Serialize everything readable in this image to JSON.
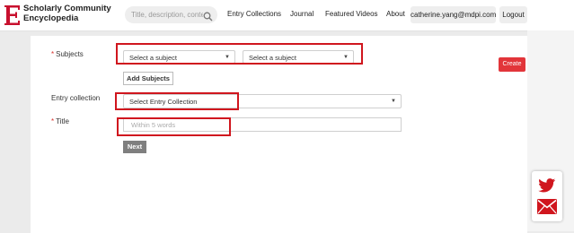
{
  "header": {
    "logo_letter": "E",
    "logo_line1": "Scholarly Community",
    "logo_line2": "Encyclopedia",
    "search_placeholder": "Title, description, content",
    "nav": {
      "entry_collections": "Entry Collections",
      "journal": "Journal",
      "featured_videos": "Featured Videos",
      "about": "About",
      "user_email": "catherine.yang@mdpi.com",
      "logout": "Logout"
    }
  },
  "form": {
    "subjects_label": "Subjects",
    "subject_select_1": "Select a subject",
    "subject_select_2": "Select a subject",
    "add_subjects": "Add Subjects",
    "entry_collection_label": "Entry collection",
    "entry_collection_select": "Select Entry Collection",
    "title_label": "Title",
    "title_placeholder": "Within 5 words",
    "required_mark": "*",
    "next": "Next"
  },
  "sidebar": {
    "create": "Create"
  },
  "share": {
    "icons": [
      "twitter-icon",
      "mail-icon"
    ]
  },
  "colors": {
    "accent": "#e2353a",
    "highlight": "#d0161e",
    "logo": "#c8102e"
  }
}
